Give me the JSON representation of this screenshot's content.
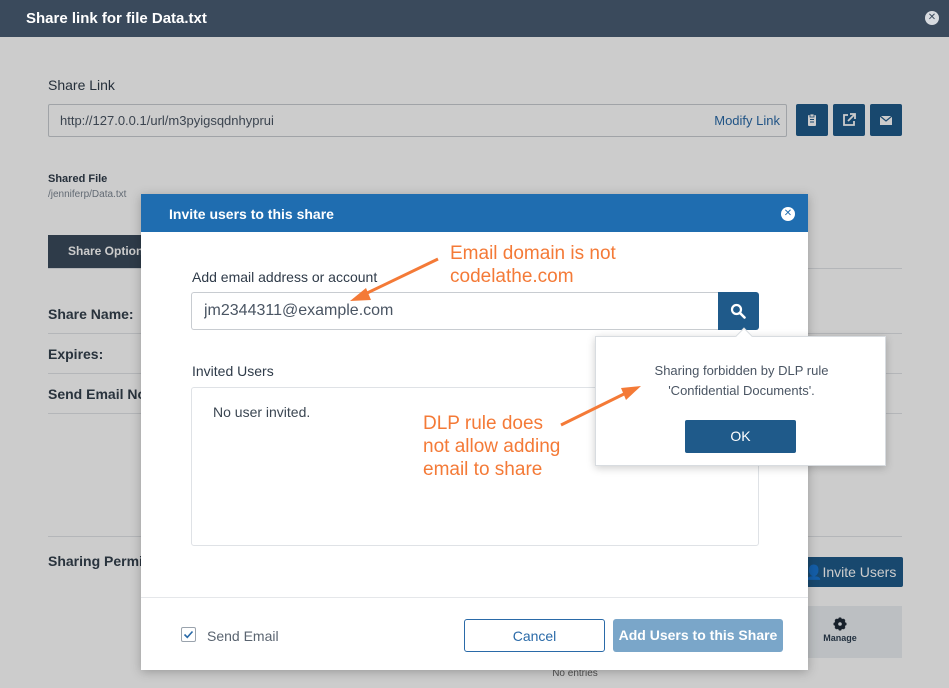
{
  "base_dialog": {
    "title": "Share link for file Data.txt",
    "share_link_label": "Share Link",
    "share_url": "http://127.0.0.1/url/m3pyigsqdnhyprui",
    "modify_link": "Modify Link",
    "shared_file_label": "Shared File",
    "shared_file_path": "/jenniferp/Data.txt",
    "share_options_tab": "Share Options",
    "share_name_label": "Share Name:",
    "expires_label": "Expires:",
    "send_email_notifications_label": "Send Email No",
    "sharing_permissions_label": "Sharing Permi",
    "invite_users_button": "Invite Users",
    "manage_column": "Manage",
    "no_entries": "No entries"
  },
  "modal": {
    "title": "Invite users to this share",
    "add_email_label": "Add email address or account",
    "email_value": "jm2344311@example.com",
    "invited_users_label": "Invited Users",
    "no_user_invited": "No user invited.",
    "send_email_label": "Send Email",
    "send_email_checked": true,
    "cancel_button": "Cancel",
    "add_users_button": "Add Users to this Share"
  },
  "dlp_popover": {
    "message_line1": "Sharing forbidden by DLP rule",
    "message_line2": "'Confidential Documents'.",
    "ok_button": "OK"
  },
  "annotations": {
    "email_domain_line1": "Email domain is not",
    "email_domain_line2": "codelathe.com",
    "dlp_line1": "DLP rule does",
    "dlp_line2": "not allow adding",
    "dlp_line3": "email to share"
  },
  "colors": {
    "header_dark": "#3a4a5c",
    "modal_header": "#1f6db0",
    "primary_button": "#1f5a8a",
    "annotation": "#f47a37"
  },
  "icons": [
    "close-icon",
    "clipboard-icon",
    "external-link-icon",
    "envelope-icon",
    "search-icon",
    "checkbox-check-icon",
    "add-user-icon",
    "gear-icon"
  ]
}
